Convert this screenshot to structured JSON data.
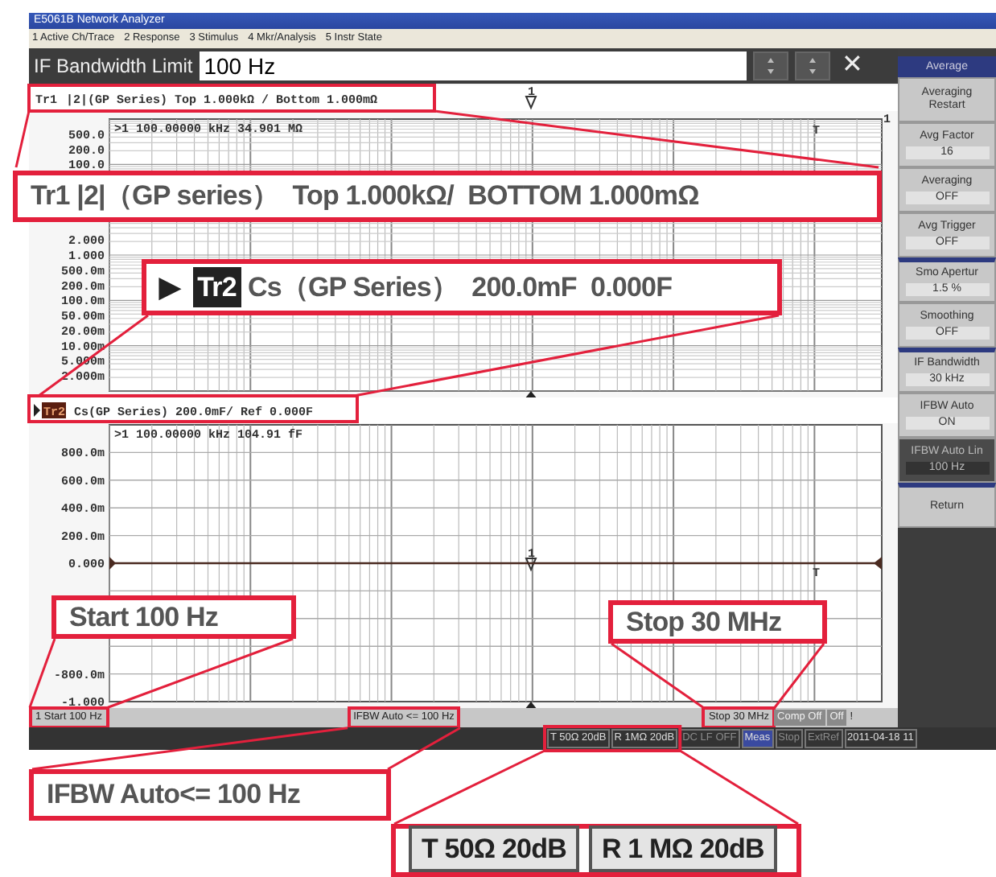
{
  "window": {
    "title": "E5061B Network Analyzer"
  },
  "menu": [
    "1 Active Ch/Trace",
    "2 Response",
    "3 Stimulus",
    "4 Mkr/Analysis",
    "5 Instr State"
  ],
  "entry": {
    "label": "IF Bandwidth Limit",
    "value": "100 Hz",
    "close": "✕"
  },
  "traces": [
    {
      "name": "Tr1",
      "active": false,
      "text": "|2|(GP Series)  Top 1.000kΩ / Bottom 1.000mΩ",
      "readout": ">1  100.00000 kHz  34.901 MΩ",
      "y_labels": [
        "500.0",
        "200.0",
        "100.0",
        "2.000",
        "1.000",
        "500.0m",
        "200.0m",
        "100.0m",
        "50.00m",
        "20.00m",
        "10.00m",
        "5.000m",
        "2.000m"
      ],
      "marker": "1",
      "trace_mark": "T",
      "channel": "1"
    },
    {
      "name": "Tr2",
      "active": true,
      "text": "Cs(GP Series)  200.0mF/ Ref 0.000F",
      "readout": ">1  100.00000 kHz  104.91 fF",
      "y_labels": [
        "800.0m",
        "600.0m",
        "400.0m",
        "200.0m",
        "0.000",
        "-800.0m",
        "-1.000"
      ],
      "marker": "1",
      "trace_mark": "T"
    }
  ],
  "softkeys": {
    "title": "Average",
    "items": [
      {
        "kind": "action",
        "label": "Averaging Restart",
        "selected": false,
        "group_start": false
      },
      {
        "kind": "setting",
        "label": "Avg Factor",
        "value": "16",
        "selected": false,
        "group_start": false
      },
      {
        "kind": "setting",
        "label": "Averaging",
        "value": "OFF",
        "selected": false,
        "group_start": false
      },
      {
        "kind": "setting",
        "label": "Avg Trigger",
        "value": "OFF",
        "selected": false,
        "group_start": false
      },
      {
        "kind": "setting",
        "label": "Smo Apertur",
        "value": "1.5 %",
        "selected": false,
        "group_start": true
      },
      {
        "kind": "setting",
        "label": "Smoothing",
        "value": "OFF",
        "selected": false,
        "group_start": false
      },
      {
        "kind": "setting",
        "label": "IF Bandwidth",
        "value": "30 kHz",
        "selected": false,
        "group_start": true
      },
      {
        "kind": "setting",
        "label": "IFBW Auto",
        "value": "ON",
        "selected": false,
        "group_start": false
      },
      {
        "kind": "setting",
        "label": "IFBW Auto Lin",
        "value": "100 Hz",
        "selected": true,
        "group_start": false
      },
      {
        "kind": "action",
        "label": "Return",
        "selected": false,
        "group_start": true
      }
    ]
  },
  "status_bar": [
    {
      "text": "1  Start 100 Hz",
      "enabled": true
    },
    {
      "text": "IFBW Auto <= 100 Hz",
      "enabled": true
    },
    {
      "text": "Stop 30 MHz",
      "enabled": true
    },
    {
      "text": "Comp Off",
      "enabled": false
    },
    {
      "text": "Off",
      "enabled": false
    },
    {
      "text": "!",
      "enabled": true
    }
  ],
  "info_bar": [
    {
      "text": "T 50Ω 20dB",
      "enabled": true,
      "selected": false
    },
    {
      "text": "R 1MΩ 20dB",
      "enabled": true,
      "selected": false
    },
    {
      "text": "DC LF OFF",
      "enabled": false,
      "selected": false
    },
    {
      "text": "Meas",
      "enabled": true,
      "selected": true
    },
    {
      "text": "Stop",
      "enabled": false,
      "selected": false
    },
    {
      "text": "ExtRef",
      "enabled": false,
      "selected": false
    },
    {
      "text": "2011-04-18 11",
      "enabled": true,
      "selected": false
    }
  ],
  "callouts": [
    {
      "kind": "text",
      "text": "Tr1 |2|（GP series）  Top 1.000kΩ/  BOTTOM 1.000mΩ"
    },
    {
      "kind": "trace",
      "arrow": "▶",
      "badge": "Tr2",
      "text": "Cs（GP Series）  200.0mF  0.000F"
    },
    {
      "kind": "text",
      "text": "Start 100 Hz"
    },
    {
      "kind": "text",
      "text": "Stop 30 MHz"
    },
    {
      "kind": "text",
      "text": "IFBW Auto<= 100 Hz"
    },
    {
      "kind": "pair",
      "items": [
        "T 50Ω 20dB",
        "R 1 MΩ 20dB"
      ]
    }
  ]
}
